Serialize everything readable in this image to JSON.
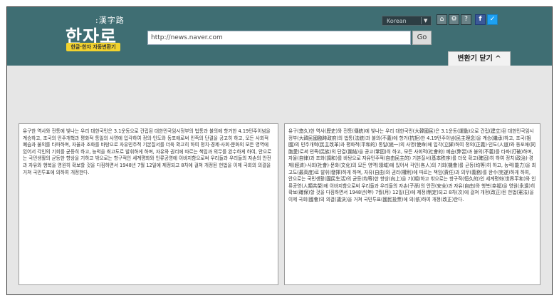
{
  "logo": {
    "hanja": ":漢字路",
    "title": "한자로",
    "badge": "한글·한자 자동변환기"
  },
  "toolbar": {
    "url_value": "http://news.naver.com",
    "go_label": "Go",
    "language": "Korean",
    "home_icon": "home-icon",
    "settings_icon": "gear-icon",
    "help_icon": "help-icon",
    "facebook_icon": "facebook-icon",
    "twitter_icon": "twitter-icon",
    "home_glyph": "⌂",
    "settings_glyph": "⚙",
    "help_glyph": "?",
    "facebook_glyph": "f",
    "twitter_glyph": "✓",
    "dropdown_glyph": "▼"
  },
  "converter": {
    "close_label": "변환기 닫기 ^",
    "input_text": "유구한 역사와 전통에 빛나는 우리 대한국민은 3.1운동으로 건립된 대한민국임시정부의 법통과 불의에 항거한 4.19민주이념을 계승하고, 조국의 민주개혁과 평화적 통일의 사명에 입각하여 정의·인도와 동포애로써 민족의 단결을 공고히 하고, 모든 사회적 폐습과 불의를 타파하며, 자율과 조화를 바탕으로 자유민주적 기본질서를 더욱 확고히 하여 정치·경제·사회·문화의 모든 영역에 있어서 각인의 기회를 균등히 하고, 능력을 최고도로 발휘하게 하며, 자유와 권리에 따르는 책임과 의무를 완수하게 하여, 안으로는 국민생활의 균등한 향상을 기하고 밖으로는 항구적인 세계평화와 인류공영에 이바지함으로써 우리들과 우리들의 자손의 안전과 자유와 행복을 영원히 확보할 것을 다짐하면서 1948년 7월 12일에 제정되고 8차에 걸쳐 개정된 헌법을 이제 국회의 의결을 거쳐 국민투표에 의하여 개정한다.",
    "output_text": "유구(悠久)한 역사(歷史)와 전통(傳統)에 빛나는 우리 대한국민(大韓國民)은 3.1운동(運動)으로 건립(建立)된 대한민국임시정부(大韓民國臨時政府)의 법통(法統)과 불의(不義)에 항거(抗拒)한 4.19민주이념(民主理念)을 계승(繼承)하고, 조국(祖國)의 민주개혁(民主改革)과 평화적(平和的) 통일(統一)의 사명(使命)에 입각(立脚)하여 정의(正義)·인도(人道)와 동포애(同胞愛)로써 민족(民族)의 단결(團結)을 공고(鞏固)히 하고, 모든 사회적(社會的) 폐습(弊習)과 불의(不義)를 타파(打破)하며, 자율(自律)과 조화(調和)를 바탕으로 자유민주적(自由民主的) 기본질서(基本秩序)를 더욱 확고(確固)히 하여 정치(政治)·경제(經濟)·사회(社會)·문화(文化)의 모든 영역(領域)에 있어서 각인(各人)의 기회(機會)를 균등(均等)히 하고, 능력(能力)을 최고도(最高度)로 발휘(發揮)하게 하며, 자유(自由)와 권리(權利)에 따르는 책임(責任)과 의무(義務)를 완수(完遂)하게 하여, 안으로는 국민생활(國民生活)의 균등(均等)한 향상(向上)을 기(期)하고 밖으로는 항구적(恒久的)인 세계평화(世界平和)와 인류공영(人類共榮)에 이바지함으로써 우리들과 우리들의 자손(子孫)의 안전(安全)과 자유(自由)와 행복(幸福)을 영원(永遠)히 확보(確保)할 것을 다짐하면서 1948년(年) 7월(月) 12일(日)에 제정(制定)되고 8차(次)에 걸쳐 개정(改正)된 헌법(憲法)을 이제 국회(國會)의 의결(議決)을 거쳐 국민투표(國民投票)에 의(依)하여 개정(改正)한다."
  },
  "colors": {
    "header_bg": "#3f6e73",
    "badge_bg": "#f2d32e",
    "workspace_bg": "#e6e6e6"
  }
}
